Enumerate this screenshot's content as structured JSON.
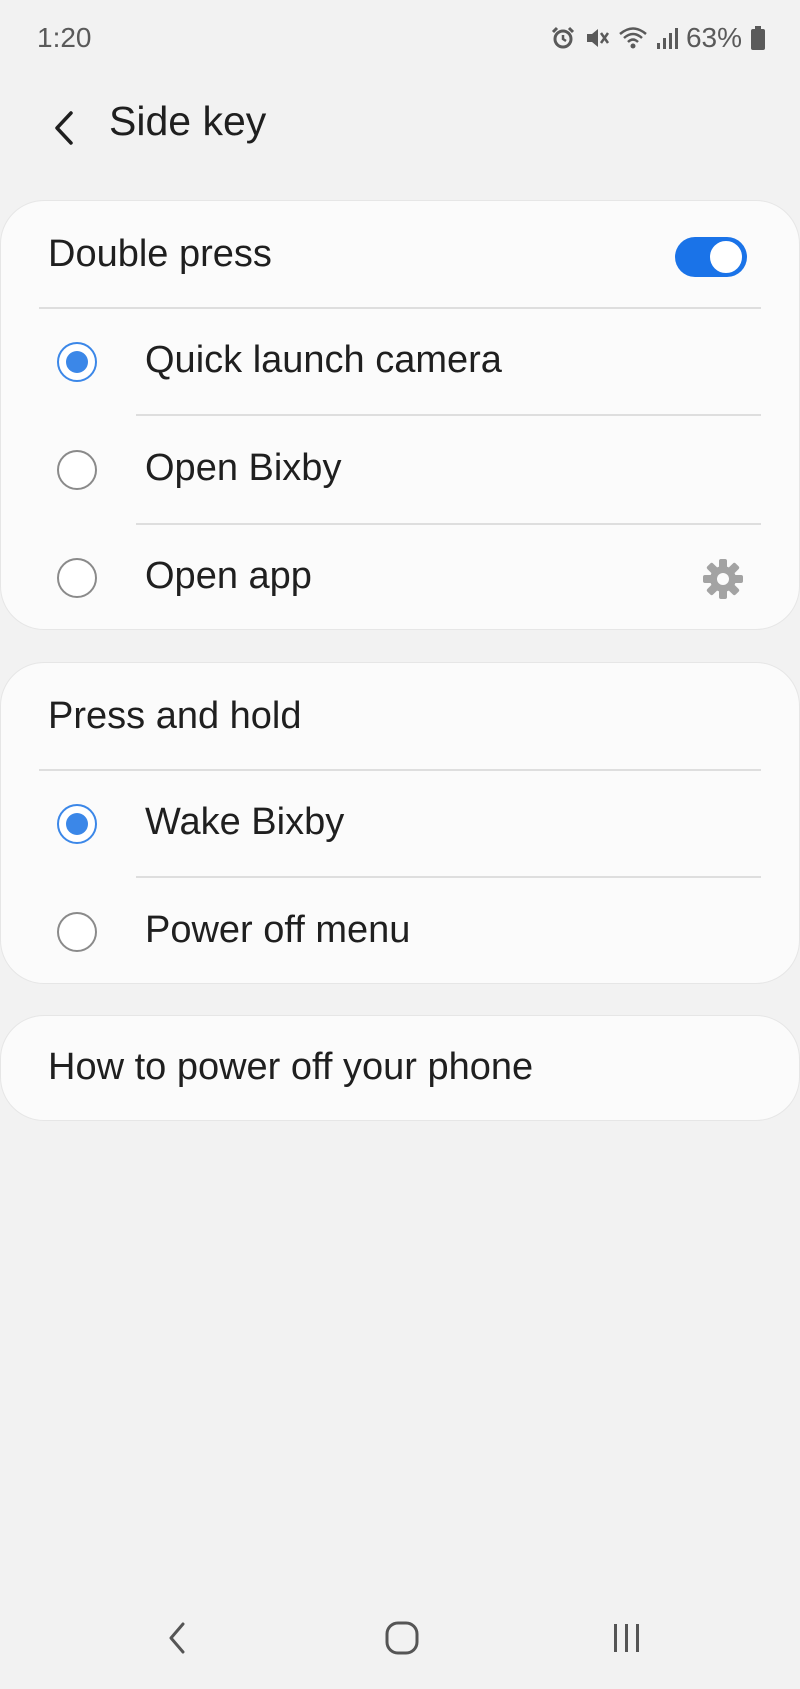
{
  "status_bar": {
    "time": "1:20",
    "battery": "63%",
    "icons": [
      "alarm-icon",
      "mute-icon",
      "wifi-icon",
      "signal-icon",
      "battery-icon"
    ]
  },
  "header": {
    "title": "Side key",
    "back_icon": "chevron-left-icon"
  },
  "double_press": {
    "label": "Double press",
    "enabled": true,
    "options": [
      {
        "label": "Quick launch camera",
        "selected": true
      },
      {
        "label": "Open Bixby",
        "selected": false
      },
      {
        "label": "Open app",
        "selected": false,
        "icon": "gear-icon"
      }
    ]
  },
  "press_and_hold": {
    "label": "Press and hold",
    "options": [
      {
        "label": "Wake Bixby",
        "selected": true
      },
      {
        "label": "Power off menu",
        "selected": false
      }
    ]
  },
  "help_link": {
    "label": "How to power off your phone"
  },
  "nav_bar": {
    "icons": [
      "back-nav-icon",
      "home-nav-icon",
      "recents-nav-icon"
    ]
  },
  "colors": {
    "accent": "#1a73e8",
    "radio_selected": "#3b87e8",
    "background": "#f2f2f2",
    "card": "#fbfbfb"
  }
}
